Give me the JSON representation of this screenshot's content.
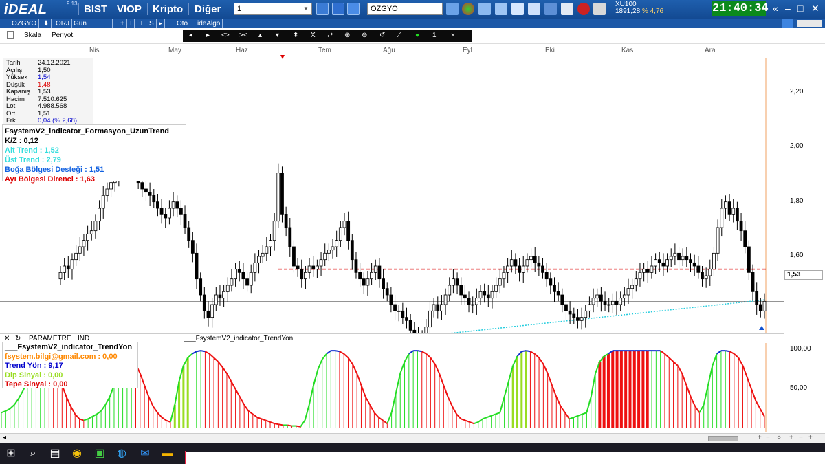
{
  "app": {
    "logo": "iDEAL",
    "version": "9.13"
  },
  "menu": [
    "BIST",
    "VIOP",
    "Kripto",
    "Diğer"
  ],
  "symbol_combo": {
    "value": "1"
  },
  "search": {
    "value": "OZGYO"
  },
  "index": {
    "name": "XU100",
    "value": "1891,28",
    "change": "% 4,76"
  },
  "clock": "21:40:34",
  "window_controls": [
    "«",
    "–",
    "□",
    "✕"
  ],
  "bar2": [
    "OZGYO",
    "⬇",
    "ORJ",
    "Gün",
    "+",
    "I",
    "T",
    "S",
    "▸",
    "Oto",
    "ideAlgo"
  ],
  "bar3": {
    "scale": "Skala",
    "period": "Periyot"
  },
  "drawbar": [
    "◂",
    "▸",
    "<>",
    "><",
    "▴",
    "▾",
    "⬍",
    "X",
    "⇄",
    "⊕",
    "⊖",
    "↺",
    "∕",
    "●",
    "1",
    "×"
  ],
  "months": [
    "Nis",
    "May",
    "Haz",
    "Tem",
    "Ağu",
    "Eyl",
    "Eki",
    "Kas",
    "Ara"
  ],
  "y_labels": [
    "2,20",
    "2,00",
    "1,80",
    "1,60",
    "1,53"
  ],
  "low_y_labels": [
    "100,00",
    "50,00"
  ],
  "info": [
    {
      "k": "Tarih",
      "v": "24.12.2021",
      "color": "#000000"
    },
    {
      "k": "Açılış",
      "v": "1,50",
      "color": "#000000"
    },
    {
      "k": "Yüksek",
      "v": "1,54",
      "color": "#0000cc"
    },
    {
      "k": "Düşük",
      "v": "1,48",
      "color": "#dd0000"
    },
    {
      "k": "Kapanış",
      "v": "1,53",
      "color": "#000000"
    },
    {
      "k": "Hacim",
      "v": "7.510.625",
      "color": "#000000"
    },
    {
      "k": "Lot",
      "v": "4.988.568",
      "color": "#000000"
    },
    {
      "k": "Ort",
      "v": "1,51",
      "color": "#000000"
    },
    {
      "k": "Frk",
      "v": "0,04 (% 2,68)",
      "color": "#0000cc"
    }
  ],
  "indicator": {
    "title": "FsystemV2_indicator_Formasyon_UzunTrend",
    "lines": [
      {
        "text": "K/Z :  0,12",
        "color": "#000000"
      },
      {
        "text": "Alt Trend :  1,52",
        "color": "#33dddd"
      },
      {
        "text": "Üst Trend :  2,79",
        "color": "#33dddd"
      },
      {
        "text": "Boğa Bölgesi Desteği :  1,51",
        "color": "#1060e0"
      },
      {
        "text": "Ayı Bölgesi Direnci :  1,63",
        "color": "#dd0000"
      }
    ]
  },
  "lowbar": {
    "param": "PARAMETRE",
    "ind": "IND",
    "title": "___FsystemV2_indicator_TrendYon"
  },
  "lower_indicator": {
    "title": "___FsystemV2_indicator_TrendYon",
    "lines": [
      {
        "text": "fsystem.bilgi@gmail.com :  0,00",
        "color": "#ff8800"
      },
      {
        "text": "Trend Yön :  9,17",
        "color": "#0000cc"
      },
      {
        "text": "Dip Sinyal :  0,00",
        "color": "#99dd22"
      },
      {
        "text": "Tepe Sinyal :  0,00",
        "color": "#dd0000"
      }
    ]
  },
  "colors": {
    "up": "#ffffff",
    "down": "#000000",
    "resist": "#dd0000",
    "support": "#22ccdd",
    "green": "#22dd22",
    "lime": "#99dd22",
    "red": "#ee1111"
  },
  "chart_data": {
    "type": "candlestick",
    "ylim": [
      1.4,
      2.3
    ],
    "closes": [
      1.62,
      1.64,
      1.63,
      1.66,
      1.68,
      1.7,
      1.72,
      1.74,
      1.75,
      1.78,
      1.82,
      1.86,
      1.88,
      1.9,
      1.92,
      1.95,
      1.98,
      2.0,
      1.98,
      1.95,
      1.9,
      1.88,
      1.87,
      1.86,
      1.84,
      1.82,
      1.8,
      1.79,
      1.82,
      1.84,
      1.82,
      1.8,
      1.76,
      1.72,
      1.68,
      1.6,
      1.55,
      1.5,
      1.48,
      1.52,
      1.55,
      1.54,
      1.56,
      1.58,
      1.6,
      1.63,
      1.62,
      1.6,
      1.58,
      1.62,
      1.65,
      1.67,
      1.68,
      1.7,
      1.72,
      1.78,
      1.93,
      1.8,
      1.76,
      1.7,
      1.64,
      1.63,
      1.6,
      1.62,
      1.64,
      1.63,
      1.64,
      1.66,
      1.68,
      1.69,
      1.7,
      1.72,
      1.76,
      1.78,
      1.72,
      1.66,
      1.62,
      1.6,
      1.58,
      1.6,
      1.62,
      1.64,
      1.6,
      1.57,
      1.55,
      1.52,
      1.5,
      1.5,
      1.48,
      1.47,
      1.44,
      1.41,
      1.42,
      1.42,
      1.45,
      1.5,
      1.52,
      1.5,
      1.52,
      1.55,
      1.58,
      1.6,
      1.58,
      1.55,
      1.54,
      1.52,
      1.52,
      1.54,
      1.56,
      1.55,
      1.54,
      1.56,
      1.58,
      1.6,
      1.62,
      1.64,
      1.66,
      1.64,
      1.62,
      1.64,
      1.66,
      1.67,
      1.65,
      1.64,
      1.62,
      1.6,
      1.58,
      1.56,
      1.55,
      1.52,
      1.5,
      1.49,
      1.48,
      1.47,
      1.48,
      1.5,
      1.52,
      1.54,
      1.55,
      1.53,
      1.52,
      1.52,
      1.53,
      1.52,
      1.54,
      1.55,
      1.57,
      1.58,
      1.6,
      1.62,
      1.63,
      1.62,
      1.64,
      1.66,
      1.65,
      1.64,
      1.66,
      1.67,
      1.68,
      1.66,
      1.67,
      1.66,
      1.65,
      1.64,
      1.62,
      1.6,
      1.61,
      1.63,
      1.68,
      1.76,
      1.82,
      1.84,
      1.8,
      1.82,
      1.78,
      1.75,
      1.7,
      1.62,
      1.56,
      1.52,
      1.5,
      1.53
    ]
  },
  "low_data": [
    20,
    22,
    25,
    30,
    38,
    48,
    60,
    72,
    80,
    85,
    88,
    86,
    80,
    70,
    55,
    40,
    28,
    18,
    12,
    10,
    12,
    15,
    18,
    22,
    30,
    40,
    55,
    70,
    82,
    88,
    90,
    82,
    70,
    55,
    40,
    28,
    20,
    14,
    10,
    8,
    30,
    60,
    80,
    90,
    95,
    98,
    99,
    98,
    95,
    90,
    85,
    78,
    70,
    60,
    50,
    40,
    30,
    22,
    18,
    14,
    12,
    10,
    8,
    6,
    5,
    4,
    4,
    3,
    3,
    2,
    10,
    30,
    55,
    75,
    88,
    95,
    99,
    99,
    98,
    95,
    90,
    82,
    70,
    55,
    40,
    30,
    20,
    14,
    10,
    6,
    20,
    45,
    70,
    85,
    95,
    99,
    99,
    98,
    95,
    90,
    82,
    70,
    55,
    40,
    28,
    18,
    12,
    10,
    8,
    6,
    8,
    12,
    14,
    16,
    18,
    20,
    40,
    60,
    80,
    92,
    98,
    99,
    98,
    95,
    90,
    82,
    70,
    55,
    40,
    28,
    20,
    12,
    14,
    16,
    18,
    20,
    40,
    70,
    85,
    92,
    95,
    99,
    99,
    99,
    99,
    99,
    99,
    99,
    99,
    99,
    99,
    99,
    99,
    95,
    90,
    85,
    80,
    70,
    55,
    40,
    28,
    20,
    30,
    55,
    80,
    95,
    99,
    99,
    98,
    95,
    90,
    80,
    65,
    50,
    35,
    25,
    15
  ]
}
